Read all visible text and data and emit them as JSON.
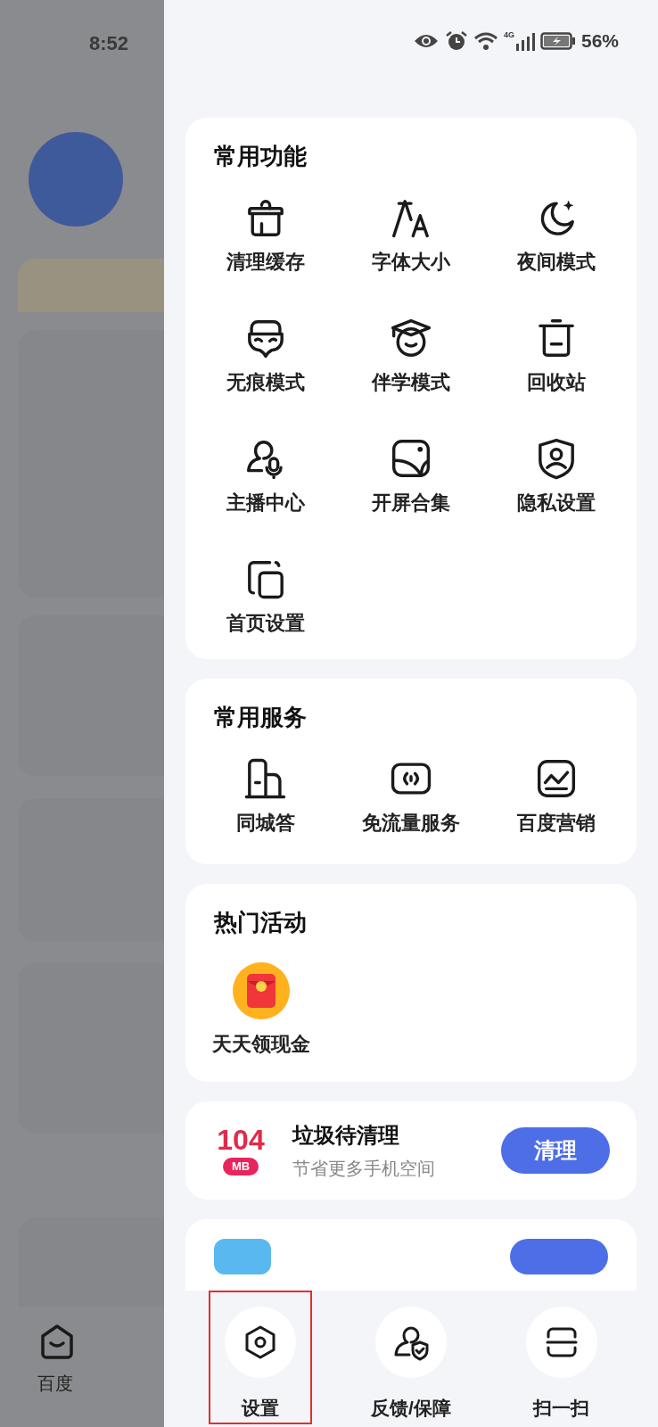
{
  "status_bar": {
    "time": "8:52",
    "network": "4G",
    "battery": "56%"
  },
  "background": {
    "tab_label": "百度"
  },
  "sections": [
    {
      "title": "常用功能",
      "items": [
        "清理缓存",
        "字体大小",
        "夜间模式",
        "无痕模式",
        "伴学模式",
        "回收站",
        "主播中心",
        "开屏合集",
        "隐私设置",
        "首页设置"
      ]
    },
    {
      "title": "常用服务",
      "items": [
        "同城答",
        "免流量服务",
        "百度营销"
      ]
    },
    {
      "title": "热门活动",
      "items": [
        "天天领现金"
      ]
    }
  ],
  "cleanup": {
    "amount": "104",
    "unit": "MB",
    "title": "垃圾待清理",
    "subtitle": "节省更多手机空间",
    "button": "清理"
  },
  "bottom_actions": [
    {
      "label": "设置",
      "highlighted": true
    },
    {
      "label": "反馈/保障",
      "highlighted": false
    },
    {
      "label": "扫一扫",
      "highlighted": false
    }
  ]
}
